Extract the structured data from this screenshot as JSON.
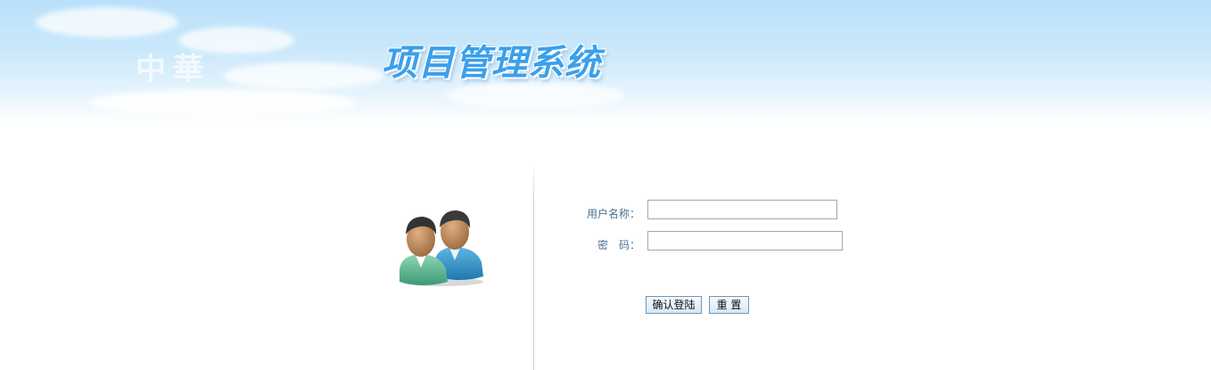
{
  "header": {
    "watermark_text": "中華",
    "system_title": "项目管理系统"
  },
  "login_form": {
    "username": {
      "label": "用户名称：",
      "value": ""
    },
    "password": {
      "label": "密　码：",
      "value": ""
    },
    "submit_label": "确认登陆",
    "reset_label": "重 置"
  },
  "icons": {
    "users": "users-icon"
  },
  "colors": {
    "title": "#3aa0ec",
    "label": "#4a6f8c",
    "sky": "#b9e0fa"
  }
}
